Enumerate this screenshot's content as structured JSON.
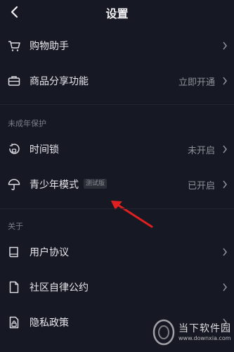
{
  "header": {
    "title": "设置"
  },
  "menu": {
    "shopping_assistant": {
      "label": "购物助手"
    },
    "product_share": {
      "label": "商品分享功能",
      "value": "立即开通"
    },
    "minor_section": {
      "title": "未成年保护"
    },
    "time_lock": {
      "label": "时间锁",
      "value": "未开启"
    },
    "youth_mode": {
      "label": "青少年模式",
      "badge": "测试版",
      "value": "已开启"
    },
    "about_section": {
      "title": "关于"
    },
    "user_agreement": {
      "label": "用户协议"
    },
    "community_rules": {
      "label": "社区自律公约"
    },
    "privacy_policy": {
      "label": "隐私政策"
    }
  },
  "watermark": {
    "brand": "当下软件园",
    "url": "www.downxia.com"
  },
  "colors": {
    "background": "#161823",
    "annotation_arrow": "#e02020"
  }
}
